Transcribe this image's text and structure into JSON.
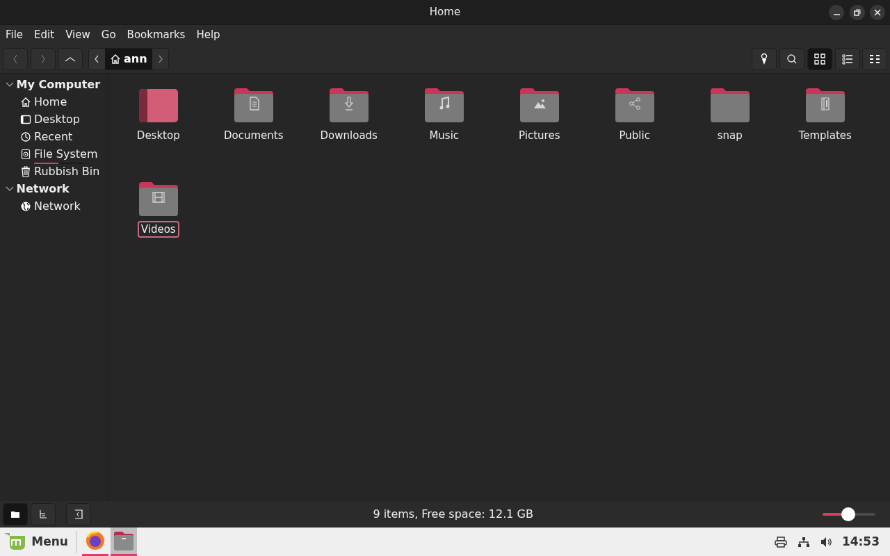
{
  "window": {
    "title": "Home"
  },
  "menu": [
    "File",
    "Edit",
    "View",
    "Go",
    "Bookmarks",
    "Help"
  ],
  "breadcrumb": {
    "location": "ann"
  },
  "view_buttons": [
    {
      "kind": "icons",
      "selected": true
    },
    {
      "kind": "list",
      "selected": false
    },
    {
      "kind": "compact",
      "selected": false
    }
  ],
  "sidebar": [
    {
      "label": "My Computer",
      "expanded": true,
      "children": [
        {
          "label": "Home",
          "kind": "home"
        },
        {
          "label": "Desktop",
          "kind": "desktop"
        },
        {
          "label": "Recent",
          "kind": "recent"
        },
        {
          "label": "File System",
          "kind": "drive",
          "level": 0.5
        },
        {
          "label": "Rubbish Bin",
          "kind": "trash"
        }
      ]
    },
    {
      "label": "Network",
      "expanded": true,
      "children": [
        {
          "label": "Network",
          "kind": "globe"
        }
      ]
    }
  ],
  "files": [
    {
      "name": "Desktop",
      "kind": "desktop",
      "selected": false
    },
    {
      "name": "Documents",
      "kind": "documents",
      "selected": false
    },
    {
      "name": "Downloads",
      "kind": "downloads",
      "selected": false
    },
    {
      "name": "Music",
      "kind": "music",
      "selected": false
    },
    {
      "name": "Pictures",
      "kind": "pictures",
      "selected": false
    },
    {
      "name": "Public",
      "kind": "public",
      "selected": false
    },
    {
      "name": "snap",
      "kind": "plain",
      "selected": false
    },
    {
      "name": "Templates",
      "kind": "templates",
      "selected": false
    },
    {
      "name": "Videos",
      "kind": "videos",
      "selected": true
    }
  ],
  "status_bar": {
    "pane_buttons": [
      {
        "kind": "places",
        "selected": true
      },
      {
        "kind": "tree",
        "selected": false
      }
    ],
    "text": "9 items, Free space: 12.1 GB",
    "zoom": {
      "level": 0.49
    }
  },
  "taskbar": {
    "menu_label": "Menu",
    "apps": [
      {
        "kind": "browser",
        "running": true,
        "selected": false
      },
      {
        "kind": "files",
        "running": true,
        "selected": true
      }
    ],
    "clock": "14:53"
  }
}
